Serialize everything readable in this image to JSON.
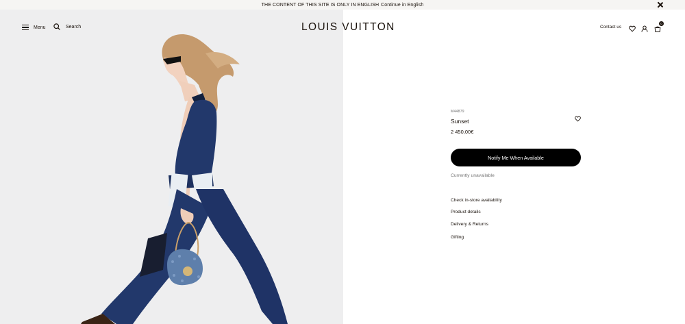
{
  "banner": {
    "message": "THE CONTENT OF THIS SITE IS ONLY IN ENGLISH",
    "continue_label": "Continue in English"
  },
  "header": {
    "menu_label": "Menu",
    "search_label": "Search",
    "logo": "LOUIS VUITTON",
    "contact_label": "Contact us",
    "bag_count": "0"
  },
  "product": {
    "sku": "M44879",
    "name": "Sunset",
    "price": "2 450,00€",
    "notify_label": "Notify Me When Available",
    "availability": "Currently unavailable"
  },
  "links": [
    {
      "label": "Check in-store availability"
    },
    {
      "label": "Product details"
    },
    {
      "label": "Delivery & Returns"
    },
    {
      "label": "Gifting"
    }
  ],
  "colors": {
    "text": "#19110b",
    "banner_bg": "#f6f5f3",
    "image_bg": "#eeeeef",
    "button_bg": "#000000",
    "jumpsuit": "#1f3366",
    "bag": "#5e7fab"
  }
}
